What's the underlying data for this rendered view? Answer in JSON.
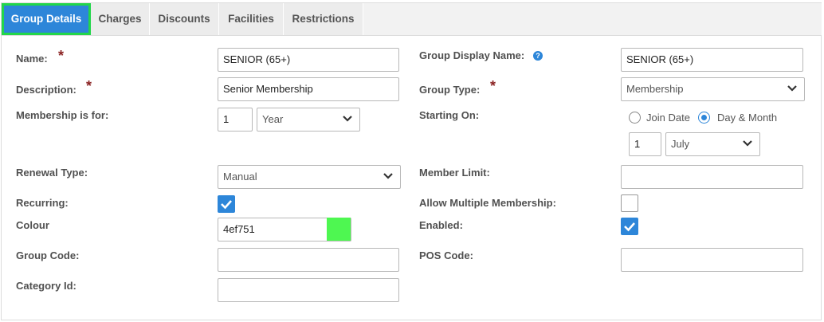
{
  "tabs": [
    {
      "label": "Group Details",
      "active": true
    },
    {
      "label": "Charges"
    },
    {
      "label": "Discounts"
    },
    {
      "label": "Facilities"
    },
    {
      "label": "Restrictions"
    }
  ],
  "form": {
    "name": {
      "label": "Name:",
      "value": "SENIOR (65+)"
    },
    "description": {
      "label": "Description:",
      "value": "Senior Membership"
    },
    "membership_for": {
      "label": "Membership is for:",
      "count": "1",
      "unit": "Year"
    },
    "renewal_type": {
      "label": "Renewal Type:",
      "value": "Manual"
    },
    "recurring": {
      "label": "Recurring:",
      "checked": true
    },
    "colour": {
      "label": "Colour",
      "value": "4ef751",
      "swatch": "#4ef751"
    },
    "group_code": {
      "label": "Group Code:",
      "value": ""
    },
    "category_id": {
      "label": "Category Id:",
      "value": ""
    },
    "group_display_name": {
      "label": "Group Display Name:",
      "value": "SENIOR (65+)"
    },
    "group_type": {
      "label": "Group Type:",
      "value": "Membership"
    },
    "starting_on": {
      "label": "Starting On:",
      "options": [
        "Join Date",
        "Day & Month"
      ],
      "selected": "Day & Month",
      "day": "1",
      "month": "July"
    },
    "member_limit": {
      "label": "Member Limit:",
      "value": ""
    },
    "allow_multiple": {
      "label": "Allow Multiple Membership:",
      "checked": false
    },
    "enabled": {
      "label": "Enabled:",
      "checked": true
    },
    "pos_code": {
      "label": "POS Code:",
      "value": ""
    }
  },
  "required_marker": "*",
  "help_glyph": "?",
  "colors": {
    "accent": "#2d86d9",
    "active_tab_border": "#22d64a",
    "required": "#8b2323"
  }
}
